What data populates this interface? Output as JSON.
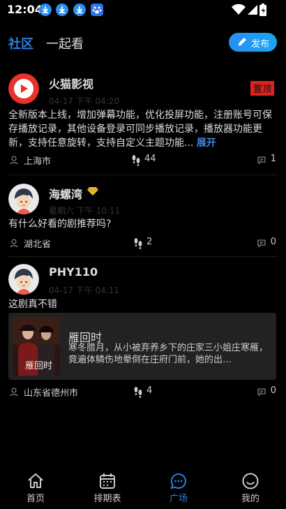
{
  "status_bar": {
    "time": "12:04"
  },
  "header": {
    "tabs": [
      {
        "label": "社区",
        "active": true
      },
      {
        "label": "一起看",
        "active": false
      }
    ],
    "publish_label": "发布"
  },
  "posts": [
    {
      "author": "火猫影视",
      "time": "04-17 下午 04:20",
      "pinned_label": "置顶",
      "content": "全新版本上线，增加弹幕功能，优化投屏功能，注册账号可保存播放记录，其他设备登录可同步播放记录，播放器功能更新，支持任意旋转，支持自定义主题功能...",
      "expand_label": "展开",
      "location": "上海市",
      "views": "44",
      "comments": "1"
    },
    {
      "author": "海螺湾",
      "time": "星期六 下午 10:11",
      "content": "有什么好看的剧推荐吗?",
      "location": "湖北省",
      "views": "2",
      "comments": "0"
    },
    {
      "author": "PHY110",
      "time": "04-17 下午 04:11",
      "content": "这剧真不错",
      "card": {
        "title": "雁回时",
        "description": "寒冬腊月，从小被弃养乡下的庄家三小姐庄寒雁，竟遍体鳞伤地晕倒在庄府门前，她的出…",
        "poster_text": "雁回时"
      },
      "location": "山东省德州市",
      "views": "4",
      "comments": "0"
    }
  ],
  "bottom_nav": [
    {
      "label": "首页",
      "icon": "home-icon",
      "active": false
    },
    {
      "label": "排期表",
      "icon": "calendar-icon",
      "active": false
    },
    {
      "label": "广场",
      "icon": "chat-bubble-icon",
      "active": true
    },
    {
      "label": "我的",
      "icon": "smile-icon",
      "active": false
    }
  ],
  "colors": {
    "accent": "#2a7fe0",
    "pin": "#e0211d",
    "background": "#000000"
  }
}
